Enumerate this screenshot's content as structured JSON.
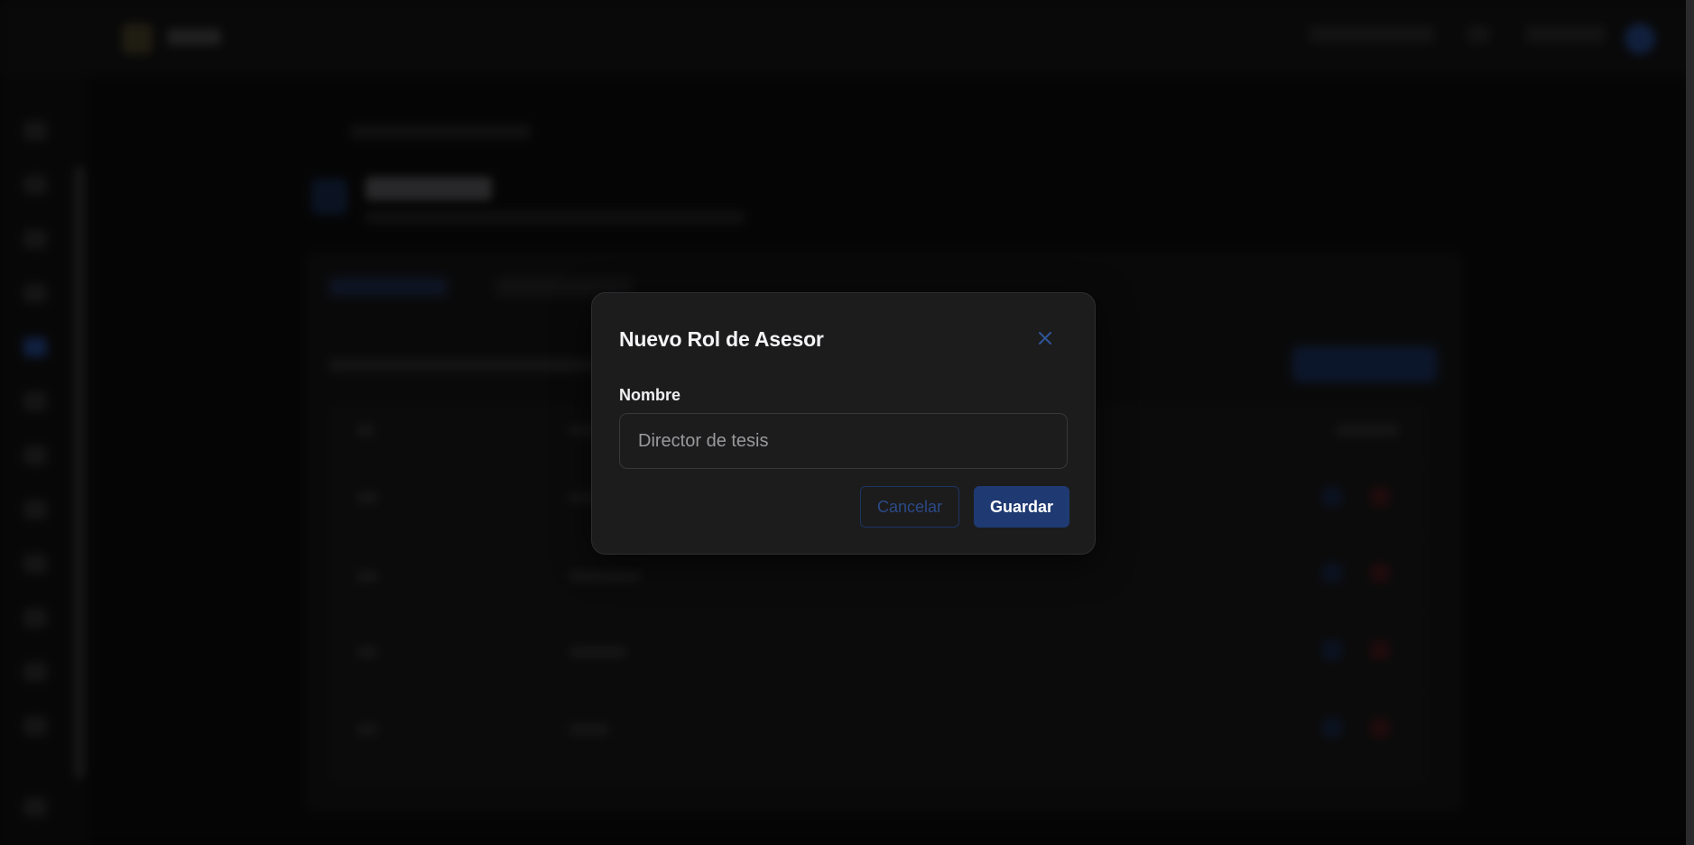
{
  "modal": {
    "title": "Nuevo Rol de Asesor",
    "close_icon": "close-icon",
    "field_label": "Nombre",
    "name_input": {
      "value": "",
      "placeholder": "Director de tesis"
    },
    "cancel_label": "Cancelar",
    "save_label": "Guardar"
  },
  "colors": {
    "accent": "#1f3a72",
    "modal_background": "#1c1c1d",
    "danger_muted": "#3a1516"
  }
}
